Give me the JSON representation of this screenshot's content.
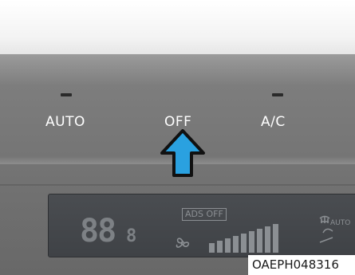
{
  "panel": {
    "buttons": [
      {
        "label": "AUTO",
        "indicator": "off"
      },
      {
        "label": "OFF",
        "indicator": "none"
      },
      {
        "label": "A/C",
        "indicator": "off"
      }
    ]
  },
  "display": {
    "temperature_big": "88",
    "temperature_small": "8",
    "ads_off_label": "ADS OFF",
    "fan_icon": "fan-icon",
    "fan_level_bars": 9,
    "mode_icon_label": "AUTO"
  },
  "highlight_arrow": {
    "color": "#2aa1e0",
    "target": "OFF"
  },
  "caption": "OAEPH048316",
  "colors": {
    "panel": "#767676",
    "lcd": "#45484c",
    "lcd_segment": "#7d8185",
    "label": "#ffffff"
  }
}
